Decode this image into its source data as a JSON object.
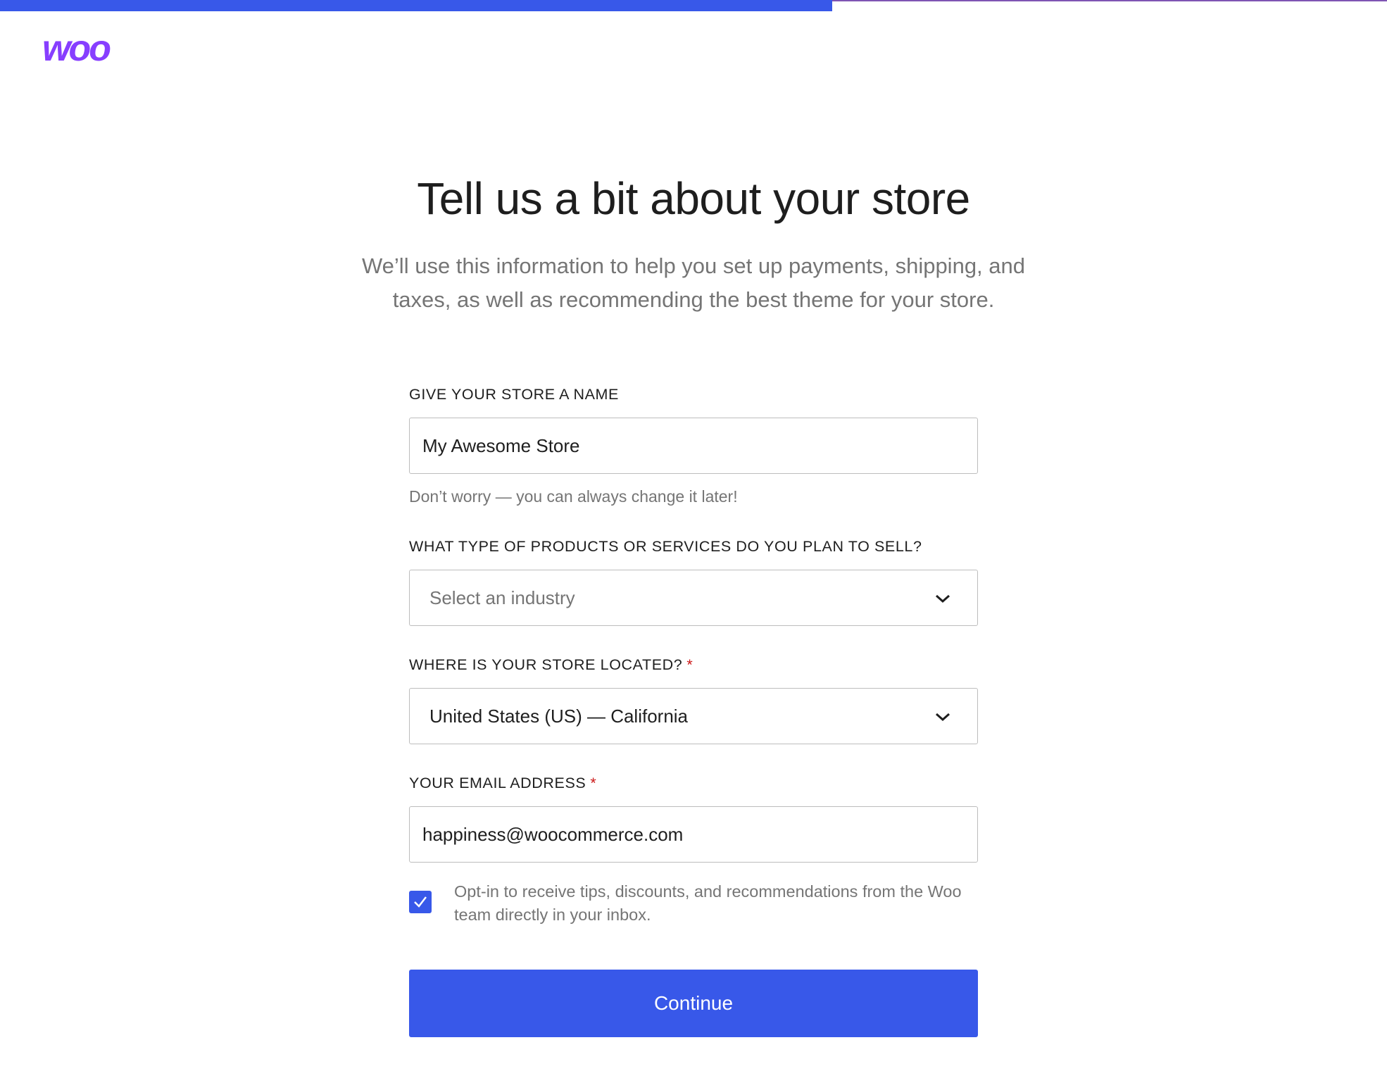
{
  "progress": {
    "fraction": 0.6
  },
  "brand": {
    "logo_text": "woo",
    "color": "#7f54b3"
  },
  "header": {
    "title": "Tell us a bit about your store",
    "subtitle": "We’ll use this information to help you set up payments, shipping, and taxes, as well as recommending the best theme for your store."
  },
  "form": {
    "store_name": {
      "label": "GIVE YOUR STORE A NAME",
      "value": "My Awesome Store",
      "help": "Don’t worry — you can always change it later!"
    },
    "industry": {
      "label": "WHAT TYPE OF PRODUCTS OR SERVICES DO YOU PLAN TO SELL?",
      "placeholder": "Select an industry"
    },
    "location": {
      "label": "WHERE IS YOUR STORE LOCATED?",
      "required_mark": "*",
      "value": "United States (US) — California"
    },
    "email": {
      "label": "YOUR EMAIL ADDRESS",
      "required_mark": "*",
      "value": "happiness@woocommerce.com"
    },
    "optin": {
      "checked": true,
      "text": "Opt-in to receive tips, discounts, and recommendations from the Woo team directly in your inbox."
    },
    "continue_label": "Continue"
  },
  "colors": {
    "accent": "#3858e9",
    "required": "#cc1818",
    "muted_text": "#757575"
  }
}
